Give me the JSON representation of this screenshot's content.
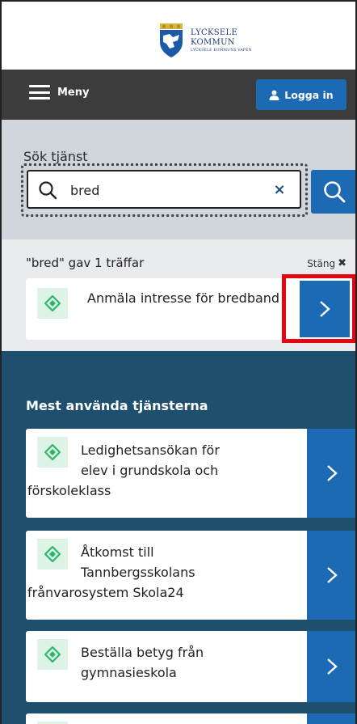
{
  "header": {
    "logo_line1": "LYCKSELE",
    "logo_line2": "KOMMUN",
    "logo_line3": "LYCKSELE KOMMUNS VAPEN"
  },
  "nav": {
    "menu_label": "Meny",
    "login_label": "Logga in"
  },
  "search": {
    "label": "Sök tjänst",
    "value": "bred",
    "clear_symbol": "×"
  },
  "results": {
    "count_text": "\"bred\" gav 1 träffar",
    "close_label": "Stäng",
    "close_symbol": "✖",
    "items": [
      {
        "title": "Anmäla intresse för bredband"
      }
    ]
  },
  "popular": {
    "heading": "Mest använda tjänsterna",
    "items": [
      {
        "line1": "Ledighetsansökan för",
        "line2": "elev i grundskola och",
        "line3": "förskoleklass"
      },
      {
        "line1": "Åtkomst till",
        "line2": "Tannbergsskolans",
        "line3": "frånvarosystem Skola24"
      },
      {
        "line1": "Beställa betyg från",
        "line2": "gymnasieskola",
        "line3": ""
      },
      {
        "line1": "",
        "line2": "",
        "line3": ""
      }
    ]
  },
  "colors": {
    "accent_blue": "#1c6ab3",
    "nav_dark": "#3c3c3c",
    "section_teal": "#1f4f6e",
    "highlight_red": "#e30613",
    "icon_green": "#2db56a"
  },
  "icons": {
    "menu": "hamburger-icon",
    "login": "user-icon",
    "search": "search-icon",
    "service": "service-diamond-icon",
    "arrow": "chevron-right-icon"
  }
}
